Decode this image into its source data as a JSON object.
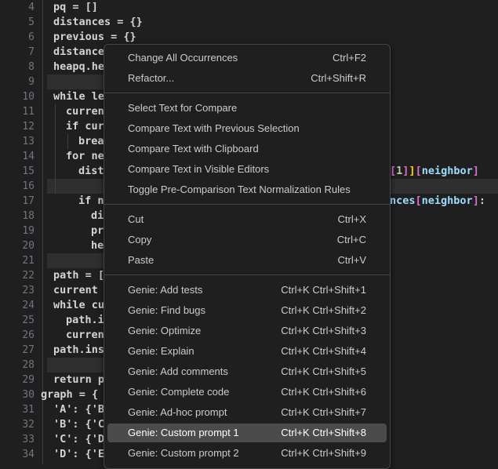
{
  "editor": {
    "lines": [
      {
        "n": "4",
        "html": "pq = []"
      },
      {
        "n": "5",
        "html": "distances = {}"
      },
      {
        "n": "6",
        "html": "previous = {}"
      },
      {
        "n": "7",
        "html": "distances"
      },
      {
        "n": "8",
        "html": "heapq.he"
      },
      {
        "n": "9",
        "html": ""
      },
      {
        "n": "10",
        "html": "while le"
      },
      {
        "n": "11",
        "html": "curren"
      },
      {
        "n": "12",
        "html": "if cur"
      },
      {
        "n": "13",
        "html": "brea"
      },
      {
        "n": "14",
        "html": "for ne"
      },
      {
        "n": "15",
        "html": "dist"
      },
      {
        "n": "16",
        "html": ""
      },
      {
        "n": "17",
        "html": "if n"
      },
      {
        "n": "18",
        "html": "di"
      },
      {
        "n": "19",
        "html": "pr"
      },
      {
        "n": "20",
        "html": "he"
      },
      {
        "n": "21",
        "html": ""
      },
      {
        "n": "22",
        "html": "path = ["
      },
      {
        "n": "23",
        "html": "current"
      },
      {
        "n": "24",
        "html": "while cu"
      },
      {
        "n": "25",
        "html": "path.i"
      },
      {
        "n": "26",
        "html": "curren"
      },
      {
        "n": "27",
        "html": "path.ins"
      },
      {
        "n": "28",
        "html": ""
      },
      {
        "n": "29",
        "html": "return p"
      },
      {
        "n": "30",
        "html": "graph = {"
      },
      {
        "n": "31",
        "html": "'A': {'B"
      },
      {
        "n": "32",
        "html": "'B': {'C"
      },
      {
        "n": "33",
        "html": "'C': {'D"
      },
      {
        "n": "34",
        "html": "'D': {'E"
      }
    ],
    "right_fragments": {
      "line15": "[1]][neighbor]",
      "line17": "nces[neighbor]:"
    }
  },
  "context_menu": {
    "groups": [
      [
        {
          "label": "Change All Occurrences",
          "shortcut": "Ctrl+F2"
        },
        {
          "label": "Refactor...",
          "shortcut": "Ctrl+Shift+R"
        }
      ],
      [
        {
          "label": "Select Text for Compare",
          "shortcut": ""
        },
        {
          "label": "Compare Text with Previous Selection",
          "shortcut": ""
        },
        {
          "label": "Compare Text with Clipboard",
          "shortcut": ""
        },
        {
          "label": "Compare Text in Visible Editors",
          "shortcut": ""
        },
        {
          "label": "Toggle Pre-Comparison Text Normalization Rules",
          "shortcut": ""
        }
      ],
      [
        {
          "label": "Cut",
          "shortcut": "Ctrl+X"
        },
        {
          "label": "Copy",
          "shortcut": "Ctrl+C"
        },
        {
          "label": "Paste",
          "shortcut": "Ctrl+V"
        }
      ],
      [
        {
          "label": "Genie: Add tests",
          "shortcut": "Ctrl+K Ctrl+Shift+1"
        },
        {
          "label": "Genie: Find bugs",
          "shortcut": "Ctrl+K Ctrl+Shift+2"
        },
        {
          "label": "Genie: Optimize",
          "shortcut": "Ctrl+K Ctrl+Shift+3"
        },
        {
          "label": "Genie: Explain",
          "shortcut": "Ctrl+K Ctrl+Shift+4"
        },
        {
          "label": "Genie: Add comments",
          "shortcut": "Ctrl+K Ctrl+Shift+5"
        },
        {
          "label": "Genie: Complete code",
          "shortcut": "Ctrl+K Ctrl+Shift+6"
        },
        {
          "label": "Genie: Ad-hoc prompt",
          "shortcut": "Ctrl+K Ctrl+Shift+7"
        },
        {
          "label": "Genie: Custom prompt 1",
          "shortcut": "Ctrl+K Ctrl+Shift+8",
          "selected": true
        },
        {
          "label": "Genie: Custom prompt 2",
          "shortcut": "Ctrl+K Ctrl+Shift+9"
        }
      ]
    ]
  }
}
